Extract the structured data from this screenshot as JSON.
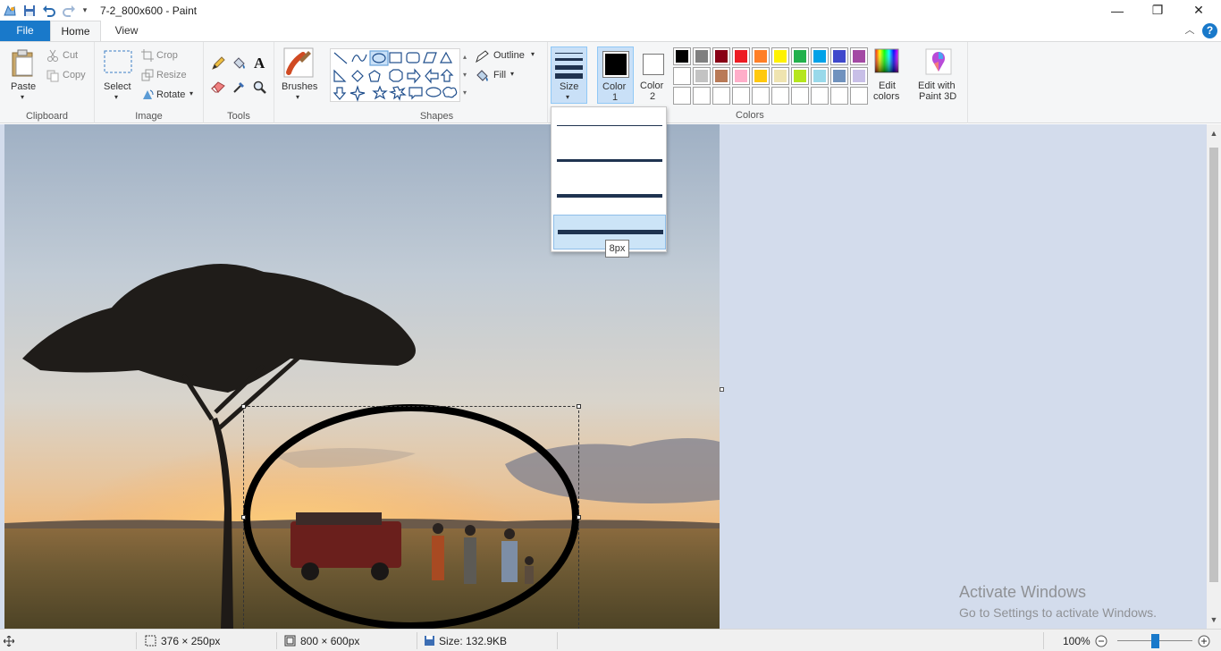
{
  "window": {
    "title": "7-2_800x600 - Paint",
    "minimize_glyph": "—",
    "maximize_glyph": "❐",
    "close_glyph": "✕"
  },
  "tabs": {
    "file": "File",
    "home": "Home",
    "view": "View",
    "help_glyph": "?"
  },
  "clipboard": {
    "paste": "Paste",
    "cut": "Cut",
    "copy": "Copy",
    "group": "Clipboard"
  },
  "image": {
    "select": "Select",
    "crop": "Crop",
    "resize": "Resize",
    "rotate": "Rotate",
    "group": "Image"
  },
  "tools": {
    "group": "Tools",
    "text_glyph": "A"
  },
  "brushes": {
    "label": "Brushes"
  },
  "shapes": {
    "outline": "Outline",
    "fill": "Fill",
    "group": "Shapes"
  },
  "size": {
    "label": "Size",
    "tooltip": "8px"
  },
  "colors": {
    "color1_line1": "Color",
    "color1_line2": "1",
    "color2_line1": "Color",
    "color2_line2": "2",
    "edit_line1": "Edit",
    "edit_line2": "colors",
    "paint3d_line1": "Edit with",
    "paint3d_line2": "Paint 3D",
    "group": "Colors",
    "palette_row1": [
      "#000000",
      "#7f7f7f",
      "#880015",
      "#ed1c24",
      "#ff7f27",
      "#fff200",
      "#22b14c",
      "#00a2e8",
      "#3f48cc",
      "#a349a4"
    ],
    "palette_row2": [
      "#ffffff",
      "#c3c3c3",
      "#b97a57",
      "#ffaec9",
      "#ffc90e",
      "#efe4b0",
      "#b5e61d",
      "#99d9ea",
      "#7092be",
      "#c8bfe7"
    ],
    "color1_value": "#000000",
    "color2_value": "#ffffff"
  },
  "watermark": {
    "line1": "Activate Windows",
    "line2": "Go to Settings to activate Windows."
  },
  "status": {
    "selection_size": "376 × 250px",
    "image_size": "800 × 600px",
    "file_size": "Size: 132.9KB",
    "zoom": "100%"
  }
}
